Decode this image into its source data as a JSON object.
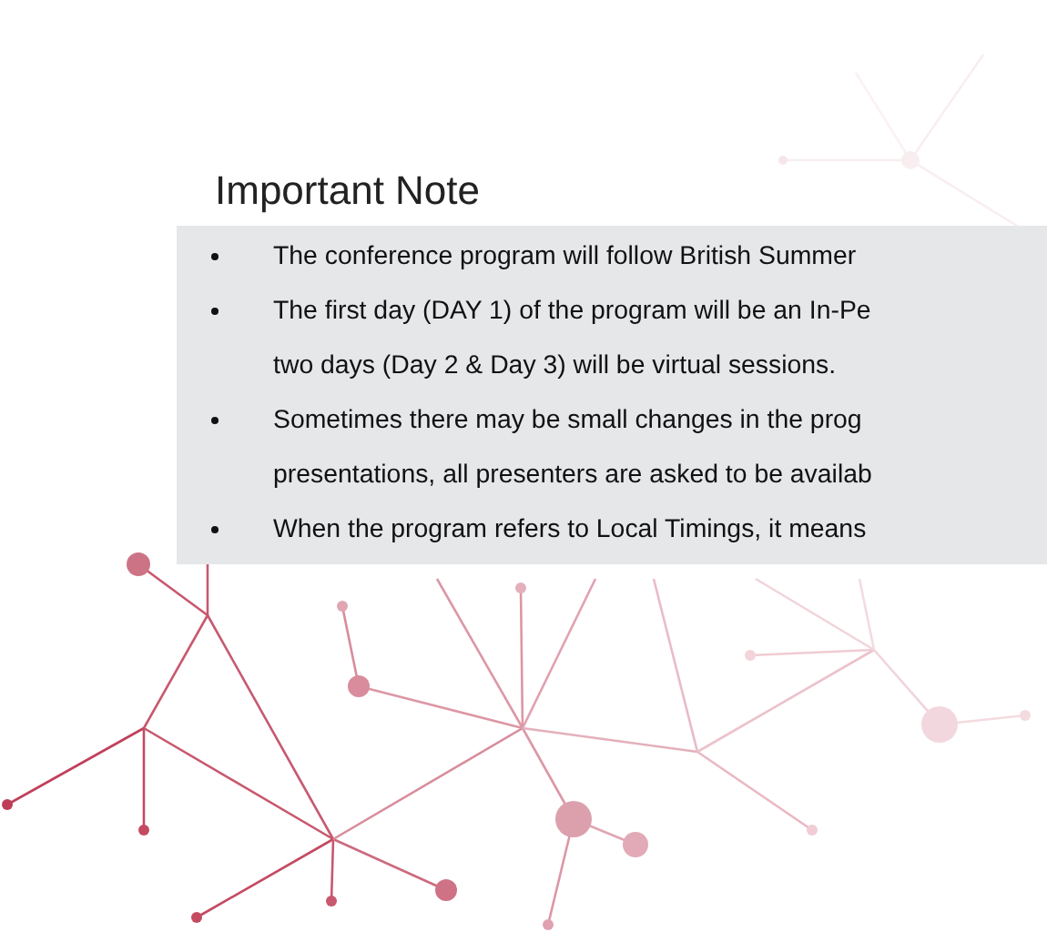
{
  "title": "Important Note",
  "notes": [
    {
      "lines": [
        "The conference program will follow British Summer"
      ]
    },
    {
      "lines": [
        "The first day (DAY 1) of the program will be an In-Pe",
        "two days (Day 2 & Day 3) will be virtual sessions."
      ]
    },
    {
      "lines": [
        "Sometimes there may be small changes in the prog",
        "presentations, all presenters are asked to be availab"
      ]
    },
    {
      "lines": [
        "When the program refers to Local Timings, it means"
      ]
    }
  ]
}
